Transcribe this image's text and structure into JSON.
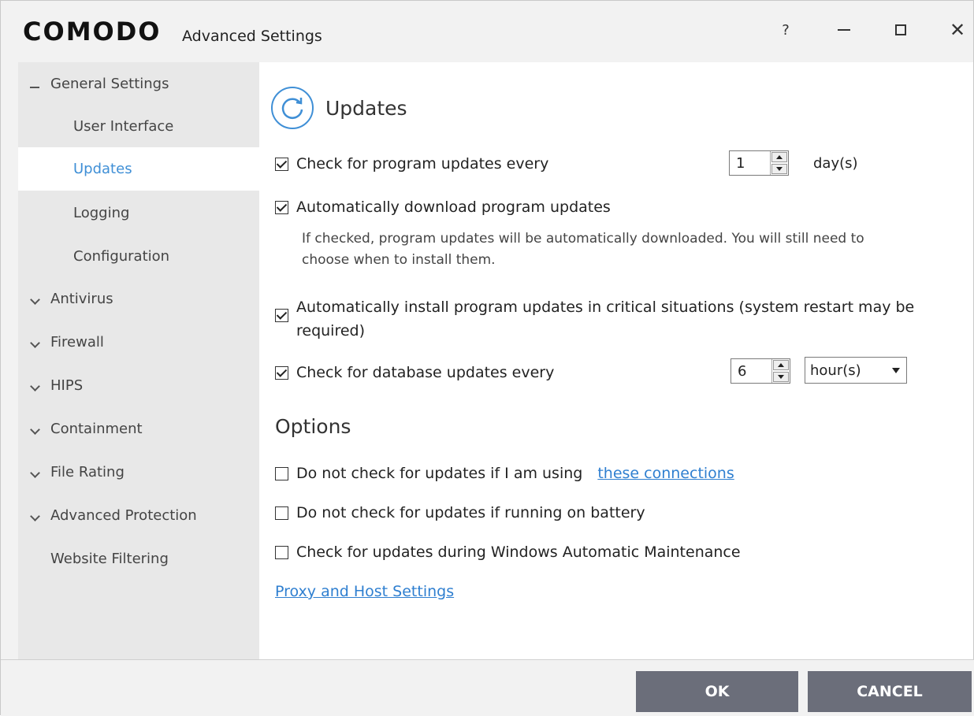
{
  "window": {
    "logo": "COMODO",
    "title": "Advanced Settings",
    "help_label": "?"
  },
  "sidebar": {
    "items": [
      {
        "label": "General Settings",
        "expanded": true
      },
      {
        "label": "User Interface"
      },
      {
        "label": "Updates",
        "selected": true
      },
      {
        "label": "Logging"
      },
      {
        "label": "Configuration"
      },
      {
        "label": "Antivirus"
      },
      {
        "label": "Firewall"
      },
      {
        "label": "HIPS"
      },
      {
        "label": "Containment"
      },
      {
        "label": "File Rating"
      },
      {
        "label": "Advanced Protection"
      },
      {
        "label": "Website Filtering"
      }
    ]
  },
  "content": {
    "title": "Updates",
    "program_updates": {
      "label": "Check for program updates every",
      "checked": true,
      "value": "1",
      "unit": "day(s)"
    },
    "auto_download": {
      "label": "Automatically download program updates",
      "checked": true,
      "description_line1": "If checked, program updates will be automatically downloaded. You will still need to",
      "description_line2": "choose when to install them."
    },
    "auto_install": {
      "label_line1": "Automatically install program updates in critical situations (system restart may be",
      "label_line2": "required)",
      "checked": true
    },
    "database_updates": {
      "label": "Check for database updates every",
      "checked": true,
      "value": "6",
      "unit_selected": "hour(s)"
    },
    "options_title": "Options",
    "options": {
      "connections_label": "Do not check for updates if I am using",
      "connections_link": "these connections",
      "battery_label": "Do not check for updates if running on battery",
      "maintenance_label": "Check for updates during Windows Automatic Maintenance"
    },
    "proxy_link": "Proxy and Host Settings"
  },
  "footer": {
    "ok_label": "OK",
    "cancel_label": "CANCEL"
  },
  "colors": {
    "accent": "#3f8fd6",
    "link": "#2f7fd0",
    "button": "#6b6e7a",
    "sidebar_bg": "#e8e8e8"
  }
}
